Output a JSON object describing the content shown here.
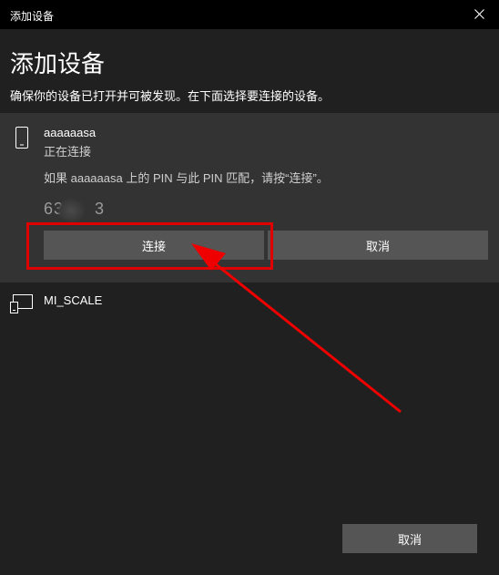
{
  "window": {
    "title": "添加设备"
  },
  "header": {
    "heading": "添加设备",
    "description": "确保你的设备已打开并可被发现。在下面选择要连接的设备。"
  },
  "devices": [
    {
      "name": "aaaaaasa",
      "status": "正在连接",
      "pin_message": "如果 aaaaaasa 上的 PIN 与此 PIN 匹配，请按“连接”。",
      "pin_code_visible": "63",
      "pin_code_visible_end": "3",
      "connect_label": "连接",
      "cancel_label": "取消"
    },
    {
      "name": "MI_SCALE"
    }
  ],
  "footer": {
    "cancel_label": "取消"
  },
  "colors": {
    "titlebar": "#000000",
    "background": "#202020",
    "panel": "#333333",
    "button": "#555555",
    "annotation": "#e00000"
  }
}
